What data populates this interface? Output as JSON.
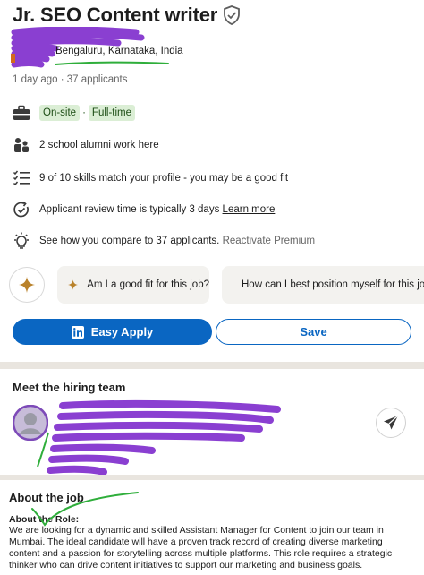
{
  "job": {
    "title": "Jr. SEO Content writer",
    "location": "Bengaluru, Karnataka, India",
    "meta": "1 day ago · 37 applicants"
  },
  "workplace": {
    "pills": [
      "On-site",
      "Full-time"
    ],
    "separator": "·"
  },
  "insights": {
    "alumni": "2 school alumni work here",
    "skills": "9 of 10 skills match your profile - you may be a good fit",
    "review_time": "Applicant review time is typically 3 days",
    "review_link": "Learn more",
    "compare": "See how you compare to 37 applicants.",
    "compare_link": "Reactivate Premium"
  },
  "ai_prompts": [
    "Am I a good fit for this job?",
    "How can I best position myself for this job?"
  ],
  "actions": {
    "apply_label": "Easy Apply",
    "save_label": "Save"
  },
  "hiring_team": {
    "heading": "Meet the hiring team"
  },
  "about": {
    "heading": "About the job",
    "role_heading": "About the Role:",
    "body": "We are looking for a dynamic and skilled Assistant Manager for Content to join our team in Mumbai. The ideal candidate will have a proven track record of creating diverse marketing content and a passion for storytelling across multiple platforms. This role requires a strategic thinker who can drive content initiatives to support our marketing and business goals."
  },
  "colors": {
    "brand_blue": "#0a66c2",
    "pill_green": "#dbeed5",
    "spark_gold": "#b9822b",
    "redaction_purple": "#8a3fd1",
    "annotation_green": "#2fae3b"
  }
}
